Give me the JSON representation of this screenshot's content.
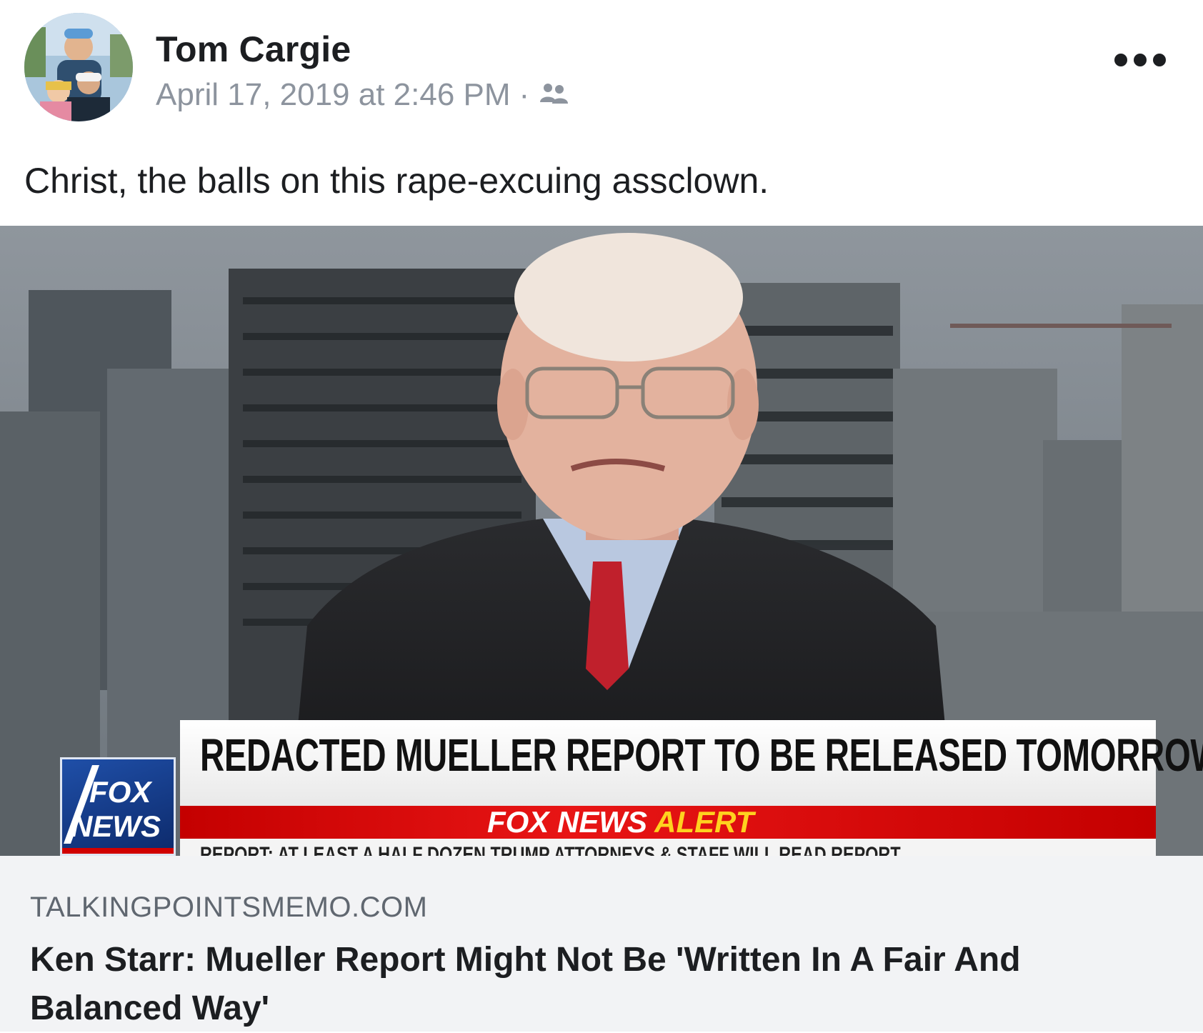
{
  "post": {
    "author": "Tom Cargie",
    "timestamp": "April 17, 2019 at 2:46 PM",
    "separator": "·",
    "audience_icon": "friends-icon",
    "more_icon": "more-options-icon",
    "text": "Christ, the balls on this rape-excuing assclown."
  },
  "media": {
    "chyron_headline": "REDACTED MUELLER REPORT TO BE RELEASED TOMORROW",
    "alert_brand": "FOX NEWS",
    "alert_word": "ALERT",
    "ticker": "REPORT: AT LEAST A HALF DOZEN TRUMP ATTORNEYS & STAFF WILL READ REPORT",
    "logo_line1": "FOX",
    "logo_line2": "NEWS"
  },
  "link_preview": {
    "domain": "TALKINGPOINTSMEMO.COM",
    "title": "Ken Starr: Mueller Report Might Not Be 'Written In A Fair And Balanced Way'"
  },
  "colors": {
    "text_primary": "#1c1e21",
    "text_secondary": "#8d949e",
    "link_bg": "#f2f3f5",
    "alert_red": "#d10000",
    "alert_yellow": "#ffd21f"
  }
}
